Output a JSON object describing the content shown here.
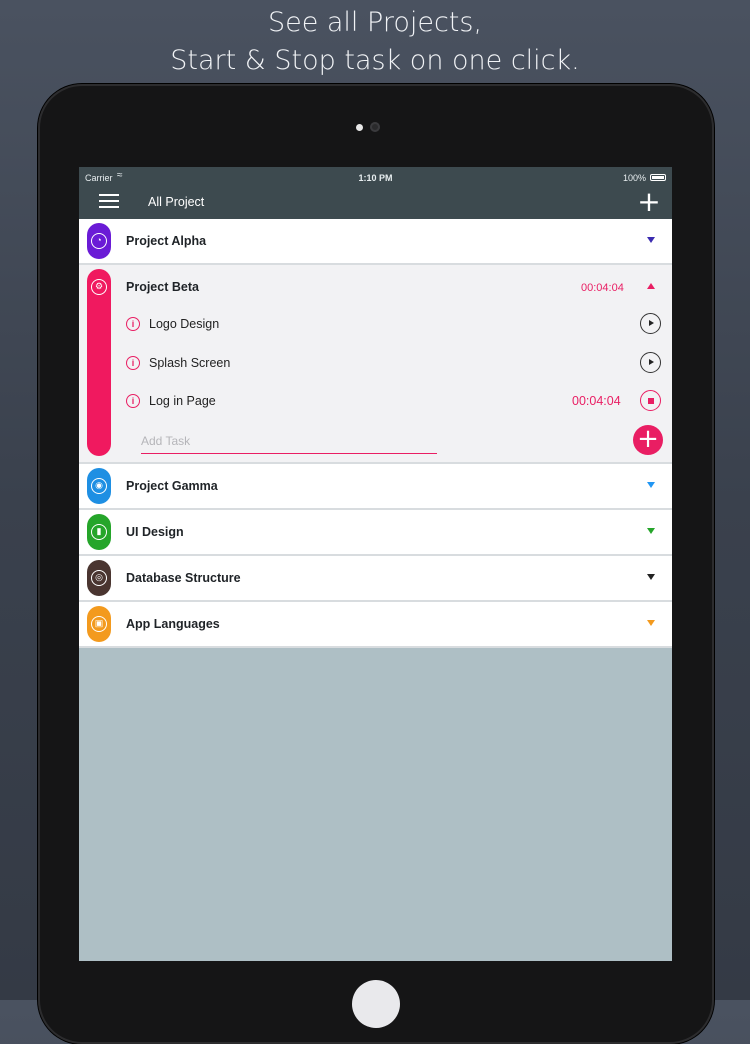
{
  "headline": {
    "line1": "See all Projects,",
    "line2": "Start & Stop task on one click."
  },
  "status_bar": {
    "carrier": "Carrier",
    "wifi_icon": "wifi-icon",
    "time": "1:10 PM",
    "battery": "100%"
  },
  "navbar": {
    "menu_icon": "hamburger-menu-icon",
    "title": "All Project",
    "add_icon": "plus-icon"
  },
  "projects": [
    {
      "name": "Project Alpha",
      "color": "#6a1bd6",
      "icon": "chart-icon",
      "expanded": false
    },
    {
      "name": "Project Beta",
      "color": "#f0195f",
      "icon": "gear-icon",
      "expanded": true,
      "time": "00:04:04",
      "tasks": [
        {
          "name": "Logo Design",
          "control": "play"
        },
        {
          "name": "Splash Screen",
          "control": "play"
        },
        {
          "name": "Log in Page",
          "time": "00:04:04",
          "control": "stop"
        }
      ],
      "add_task_placeholder": "Add Task"
    },
    {
      "name": "Project Gamma",
      "color": "#1e8fe3",
      "icon": "camera-icon",
      "expanded": false
    },
    {
      "name": "UI Design",
      "color": "#25a52a",
      "icon": "bar-chart-icon",
      "expanded": false
    },
    {
      "name": "Database Structure",
      "color": "#4a3530",
      "icon": "globe-icon",
      "expanded": false
    },
    {
      "name": "App Languages",
      "color": "#f39a1e",
      "icon": "briefcase-icon",
      "expanded": false
    }
  ],
  "caret_colors": [
    "#3b2bb0",
    "#e91e63",
    "#2196f3",
    "#25a52a",
    "#222222",
    "#f39a1e"
  ]
}
